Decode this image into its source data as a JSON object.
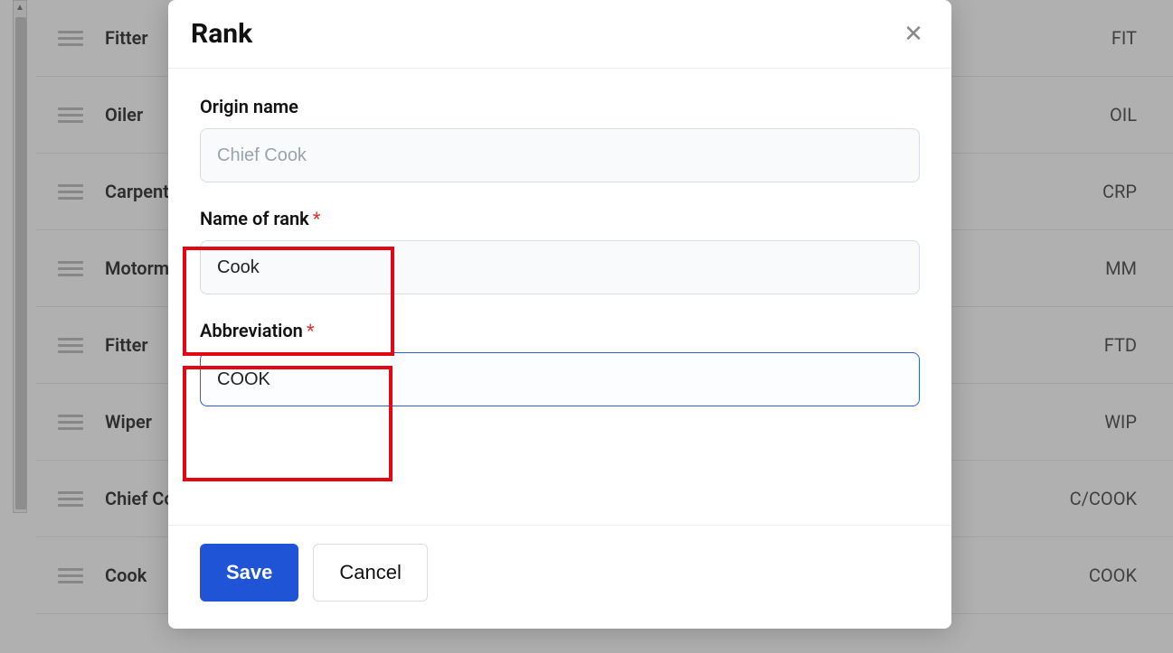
{
  "table": {
    "rows": [
      {
        "name": "Fitter",
        "abbr": "FIT"
      },
      {
        "name": "Oiler",
        "abbr": "OIL"
      },
      {
        "name": "Carpenter",
        "abbr": "CRP"
      },
      {
        "name": "Motorman",
        "abbr": "MM"
      },
      {
        "name": "Fitter",
        "abbr": "FTD"
      },
      {
        "name": "Wiper",
        "abbr": "WIP"
      },
      {
        "name": "Chief Cook",
        "abbr": "C/COOK"
      },
      {
        "name": "Cook",
        "abbr": "COOK"
      }
    ]
  },
  "modal": {
    "title": "Rank",
    "origin_label": "Origin name",
    "origin_value": "Chief Cook",
    "name_label": "Name of rank",
    "name_value": "Cook",
    "abbr_label": "Abbreviation",
    "abbr_value": "COOK",
    "save_label": "Save",
    "cancel_label": "Cancel"
  }
}
